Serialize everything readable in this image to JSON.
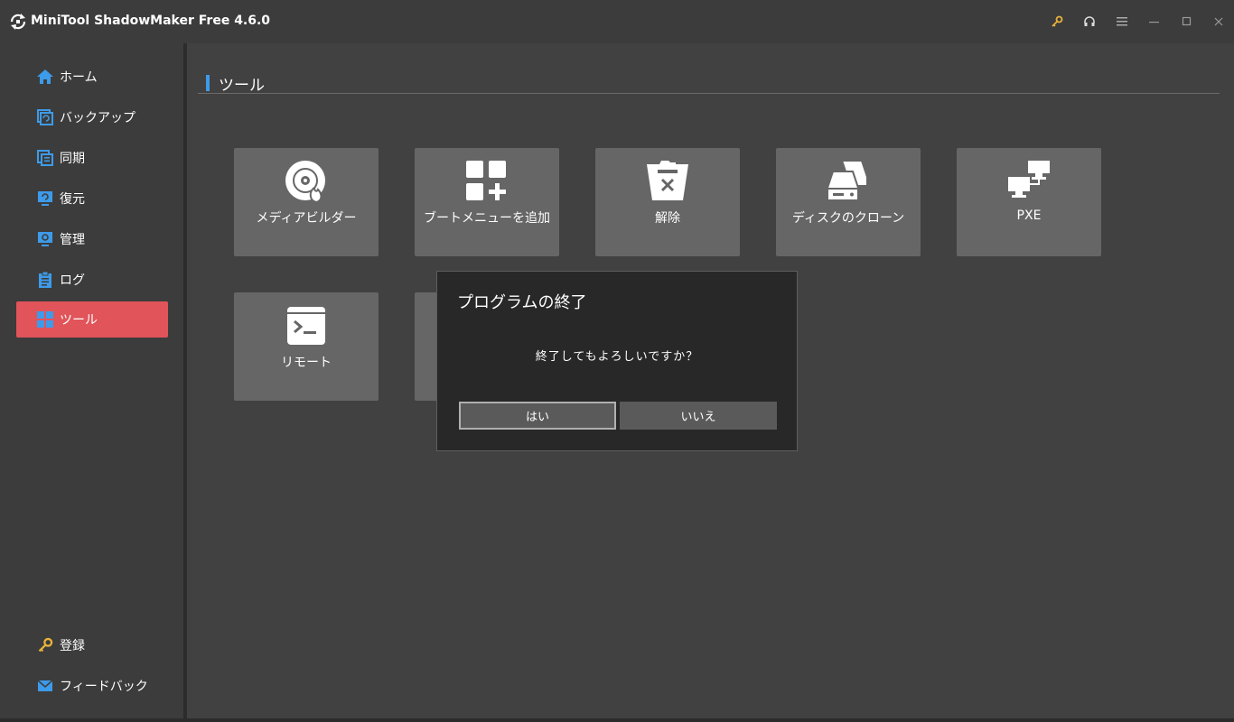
{
  "app": {
    "title": "MiniTool ShadowMaker Free 4.6.0"
  },
  "window_controls": [
    {
      "icon": "key-icon",
      "color": "#e8b33a"
    },
    {
      "icon": "headset-icon"
    },
    {
      "icon": "menu-icon"
    },
    {
      "icon": "minimize-icon"
    },
    {
      "icon": "maximize-icon"
    },
    {
      "icon": "close-icon"
    }
  ],
  "sidebar": {
    "items": [
      {
        "label": "ホーム",
        "icon": "home-icon"
      },
      {
        "label": "バックアップ",
        "icon": "backup-icon"
      },
      {
        "label": "同期",
        "icon": "sync-icon"
      },
      {
        "label": "復元",
        "icon": "restore-icon"
      },
      {
        "label": "管理",
        "icon": "manage-icon"
      },
      {
        "label": "ログ",
        "icon": "log-icon"
      },
      {
        "label": "ツール",
        "icon": "tools-icon",
        "active": true
      }
    ],
    "bottom_items": [
      {
        "label": "登録",
        "icon": "key-icon"
      },
      {
        "label": "フィードバック",
        "icon": "mail-icon"
      }
    ]
  },
  "main": {
    "section_title": "ツール",
    "tools": [
      {
        "label": "メディアビルダー",
        "icon": "media-builder-icon"
      },
      {
        "label": "ブートメニューを追加",
        "icon": "add-boot-menu-icon"
      },
      {
        "label": "解除",
        "icon": "unmount-icon"
      },
      {
        "label": "ディスクのクローン",
        "icon": "clone-disk-icon"
      },
      {
        "label": "PXE",
        "icon": "pxe-icon"
      },
      {
        "label": "リモート",
        "icon": "remote-icon"
      }
    ]
  },
  "dialog": {
    "title": "プログラムの終了",
    "message": "終了してもよろしいですか？",
    "yes_label": "はい",
    "no_label": "いいえ"
  },
  "colors": {
    "accent_active": "#e0545a",
    "icon_blue": "#3d9be9",
    "key_gold": "#e8b33a"
  }
}
